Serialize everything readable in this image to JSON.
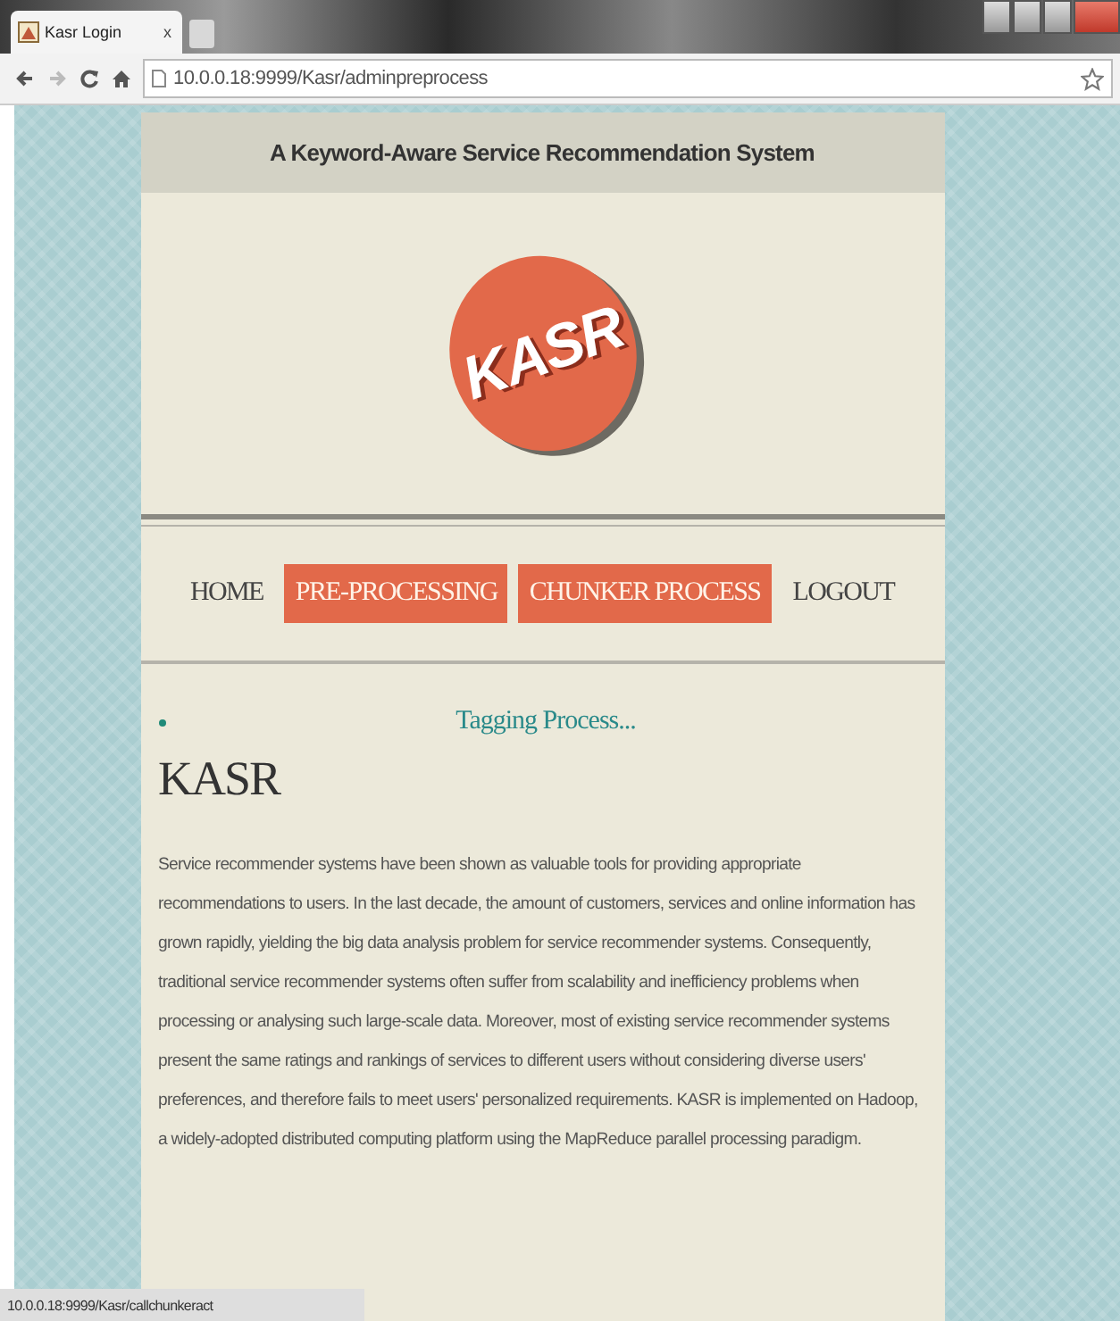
{
  "browser": {
    "tab": {
      "title": "Kasr Login",
      "close": "x"
    },
    "address": "10.0.0.18:9999/Kasr/adminpreprocess"
  },
  "header": {
    "title": "A Keyword-Aware Service Recommendation System"
  },
  "logo": {
    "text": "KASR"
  },
  "nav": [
    {
      "label": "HOME",
      "highlighted": false
    },
    {
      "label": "PRE-PROCESSING",
      "highlighted": true
    },
    {
      "label": "CHUNKER PROCESS",
      "highlighted": true
    },
    {
      "label": "LOGOUT",
      "highlighted": false
    }
  ],
  "content": {
    "status": "Tagging Process...",
    "heading": "KASR",
    "paragraph": "Service recommender systems have been shown as valuable tools for providing appropriate recommendations to users. In the last decade, the amount of customers, services and online information has grown rapidly, yielding the big data analysis problem for service recommender systems. Consequently, traditional service recommender systems often suffer from scalability and inefficiency problems when processing or analysing such large-scale data. Moreover, most of existing service recommender systems present the same ratings and rankings of services to different users without considering diverse users' preferences, and therefore fails to meet users' personalized requirements. KASR is implemented on Hadoop, a widely-adopted distributed computing platform using the MapReduce parallel processing paradigm."
  },
  "status_bar": {
    "url": "10.0.0.18:9999/Kasr/callchunkeract"
  }
}
